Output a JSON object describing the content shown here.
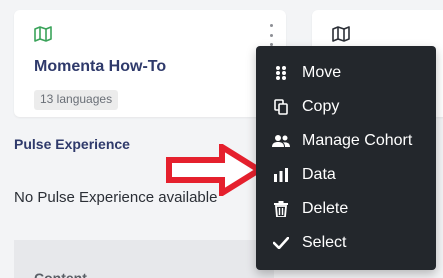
{
  "cards": [
    {
      "title": "Momenta How-To",
      "badge": "13 languages",
      "icon": "map-icon",
      "icon_color": "#3aa35a"
    },
    {
      "title": "",
      "icon": "map-icon",
      "icon_color": "#2b2f36"
    }
  ],
  "pulse": {
    "title": "Pulse Experience",
    "empty_text": "No Pulse Experience available"
  },
  "content": {
    "label": "Content"
  },
  "menu": {
    "items": [
      {
        "label": "Move",
        "icon": "drag-grid-icon"
      },
      {
        "label": "Copy",
        "icon": "copy-icon"
      },
      {
        "label": "Manage Cohort",
        "icon": "users-icon"
      },
      {
        "label": "Data",
        "icon": "bar-chart-icon"
      },
      {
        "label": "Delete",
        "icon": "trash-icon"
      },
      {
        "label": "Select",
        "icon": "check-icon"
      }
    ]
  },
  "colors": {
    "menu_bg": "#23272c",
    "title_blue": "#2f3a6b",
    "arrow_red": "#e5202d",
    "map_green": "#3aa35a"
  }
}
